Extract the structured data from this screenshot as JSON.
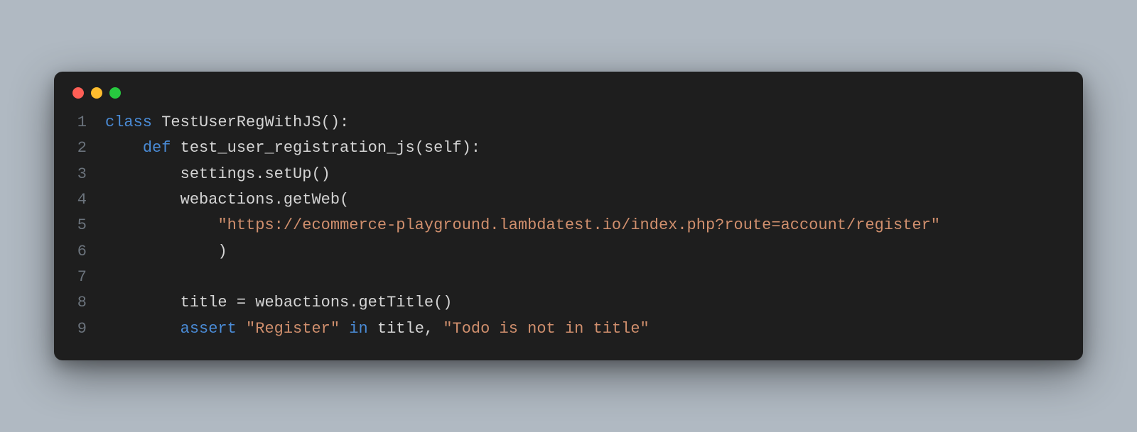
{
  "window": {
    "traffic_lights": [
      "close",
      "minimize",
      "zoom"
    ]
  },
  "code": {
    "line_numbers": [
      "1",
      "2",
      "3",
      "4",
      "5",
      "6",
      "7",
      "8",
      "9"
    ],
    "lines": [
      {
        "indent": 0,
        "tokens": [
          {
            "t": "kw",
            "v": "class"
          },
          {
            "t": "sp",
            "v": " "
          },
          {
            "t": "name",
            "v": "TestUserRegWithJS"
          },
          {
            "t": "punct",
            "v": "():"
          }
        ]
      },
      {
        "indent": 1,
        "tokens": [
          {
            "t": "kw",
            "v": "def"
          },
          {
            "t": "sp",
            "v": " "
          },
          {
            "t": "name",
            "v": "test_user_registration_js"
          },
          {
            "t": "punct",
            "v": "(self):"
          }
        ]
      },
      {
        "indent": 2,
        "tokens": [
          {
            "t": "name",
            "v": "settings.setUp()"
          }
        ]
      },
      {
        "indent": 2,
        "tokens": [
          {
            "t": "name",
            "v": "webactions.getWeb("
          }
        ]
      },
      {
        "indent": 3,
        "tokens": [
          {
            "t": "str",
            "v": "\"https://ecommerce-playground.lambdatest.io/index.php?route=account/register\""
          }
        ]
      },
      {
        "indent": 3,
        "tokens": [
          {
            "t": "name",
            "v": ")"
          }
        ]
      },
      {
        "indent": 0,
        "tokens": []
      },
      {
        "indent": 2,
        "tokens": [
          {
            "t": "name",
            "v": "title = webactions.getTitle()"
          }
        ]
      },
      {
        "indent": 2,
        "tokens": [
          {
            "t": "kw",
            "v": "assert"
          },
          {
            "t": "sp",
            "v": " "
          },
          {
            "t": "str",
            "v": "\"Register\""
          },
          {
            "t": "sp",
            "v": " "
          },
          {
            "t": "kw",
            "v": "in"
          },
          {
            "t": "sp",
            "v": " "
          },
          {
            "t": "name",
            "v": "title, "
          },
          {
            "t": "str",
            "v": "\"Todo is not in title\""
          }
        ]
      }
    ]
  },
  "colors": {
    "background_page": "#b0b9c2",
    "background_window": "#1e1e1e",
    "keyword": "#4a8bd6",
    "string": "#d08f6d",
    "text": "#d4d4d4",
    "lineno": "#6b737c",
    "traffic_red": "#ff5f56",
    "traffic_yellow": "#ffbd2e",
    "traffic_green": "#27c93f"
  }
}
